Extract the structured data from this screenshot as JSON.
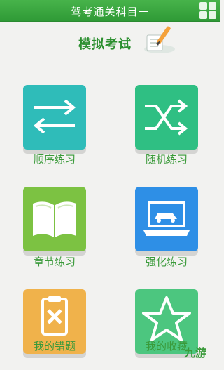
{
  "header": {
    "title": "驾考通关科目一"
  },
  "section": {
    "title": "模拟考试"
  },
  "menu": [
    {
      "label": "顺序练习",
      "icon": "arrows-left-right-icon",
      "color": "#2fbcb9"
    },
    {
      "label": "随机练习",
      "icon": "shuffle-icon",
      "color": "#2fbf83"
    },
    {
      "label": "章节练习",
      "icon": "open-book-icon",
      "color": "#7cc242"
    },
    {
      "label": "强化练习",
      "icon": "laptop-car-icon",
      "color": "#2e8fe6"
    },
    {
      "label": "我的错题",
      "icon": "clipboard-x-icon",
      "color": "#f0b24b"
    },
    {
      "label": "我的收藏",
      "icon": "star-icon",
      "color": "#4cc67f"
    }
  ],
  "watermark": {
    "text": "九游"
  }
}
